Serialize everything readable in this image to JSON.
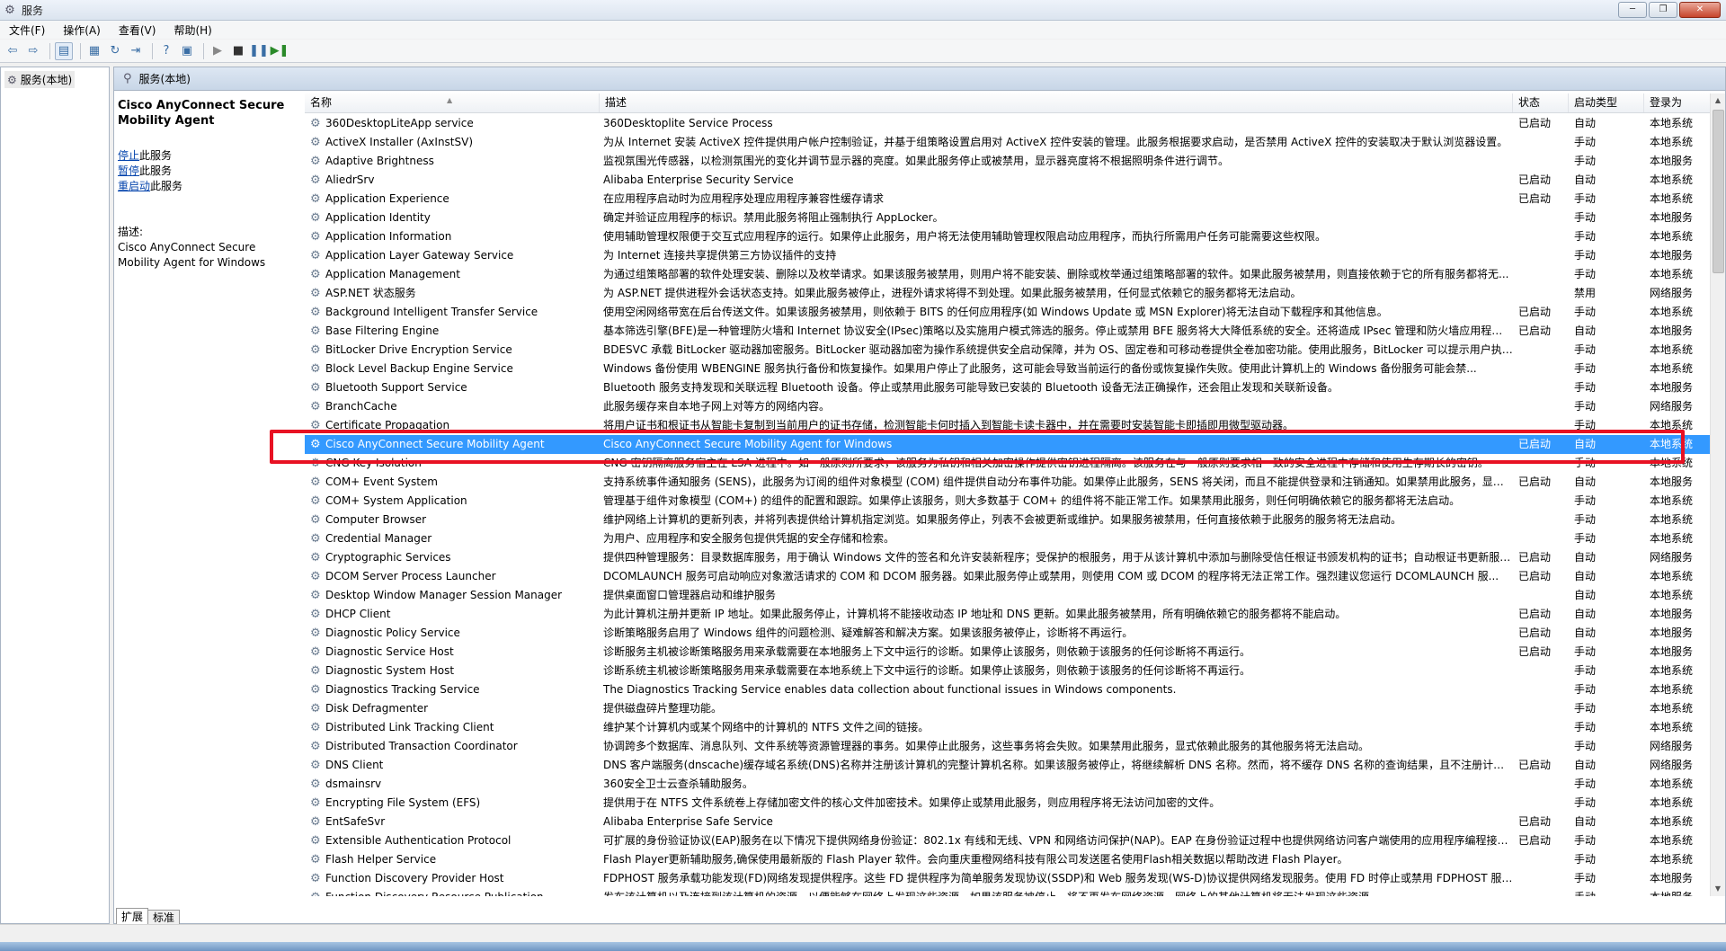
{
  "window": {
    "title": "服务"
  },
  "menu": [
    "文件(F)",
    "操作(A)",
    "查看(V)",
    "帮助(H)"
  ],
  "tree": {
    "root_label": "服务(本地)"
  },
  "main": {
    "header": "服务(本地)"
  },
  "detail": {
    "service_name": "Cisco AnyConnect Secure Mobility Agent",
    "actions": [
      {
        "link": "停止",
        "suffix": "此服务"
      },
      {
        "link": "暂停",
        "suffix": "此服务"
      },
      {
        "link": "重启动",
        "suffix": "此服务"
      }
    ],
    "desc_label": "描述:",
    "desc_text": "Cisco AnyConnect Secure Mobility Agent for Windows"
  },
  "columns": {
    "name": "名称",
    "desc": "描述",
    "status": "状态",
    "startup": "启动类型",
    "logon": "登录为"
  },
  "rows": [
    {
      "name": "360DesktopLiteApp service",
      "desc": "360Desktoplite Service Process",
      "status": "已启动",
      "startup": "自动",
      "logon": "本地系统"
    },
    {
      "name": "ActiveX Installer (AxInstSV)",
      "desc": "为从 Internet 安装 ActiveX 控件提供用户帐户控制验证，并基于组策略设置启用对 ActiveX 控件安装的管理。此服务根据要求启动，是否禁用 ActiveX 控件的安装取决于默认浏览器设置。",
      "status": "",
      "startup": "手动",
      "logon": "本地系统"
    },
    {
      "name": "Adaptive Brightness",
      "desc": "监视氛围光传感器，以检测氛围光的变化并调节显示器的亮度。如果此服务停止或被禁用，显示器亮度将不根据照明条件进行调节。",
      "status": "",
      "startup": "手动",
      "logon": "本地服务"
    },
    {
      "name": "AliedrSrv",
      "desc": "Alibaba Enterprise Security Service",
      "status": "已启动",
      "startup": "自动",
      "logon": "本地系统"
    },
    {
      "name": "Application Experience",
      "desc": "在应用程序启动时为应用程序处理应用程序兼容性缓存请求",
      "status": "已启动",
      "startup": "手动",
      "logon": "本地系统"
    },
    {
      "name": "Application Identity",
      "desc": "确定并验证应用程序的标识。禁用此服务将阻止强制执行 AppLocker。",
      "status": "",
      "startup": "手动",
      "logon": "本地服务"
    },
    {
      "name": "Application Information",
      "desc": "使用辅助管理权限便于交互式应用程序的运行。如果停止此服务，用户将无法使用辅助管理权限启动应用程序，而执行所需用户任务可能需要这些权限。",
      "status": "",
      "startup": "手动",
      "logon": "本地系统"
    },
    {
      "name": "Application Layer Gateway Service",
      "desc": "为 Internet 连接共享提供第三方协议插件的支持",
      "status": "",
      "startup": "手动",
      "logon": "本地服务"
    },
    {
      "name": "Application Management",
      "desc": "为通过组策略部署的软件处理安装、删除以及枚举请求。如果该服务被禁用，则用户将不能安装、删除或枚举通过组策略部署的软件。如果此服务被禁用，则直接依赖于它的所有服务都将无...",
      "status": "",
      "startup": "手动",
      "logon": "本地系统"
    },
    {
      "name": "ASP.NET 状态服务",
      "desc": "为 ASP.NET 提供进程外会话状态支持。如果此服务被停止，进程外请求将得不到处理。如果此服务被禁用，任何显式依赖它的服务都将无法启动。",
      "status": "",
      "startup": "禁用",
      "logon": "网络服务"
    },
    {
      "name": "Background Intelligent Transfer Service",
      "desc": "使用空闲网络带宽在后台传送文件。如果该服务被禁用，则依赖于 BITS 的任何应用程序(如 Windows Update 或 MSN Explorer)将无法自动下载程序和其他信息。",
      "status": "已启动",
      "startup": "手动",
      "logon": "本地系统"
    },
    {
      "name": "Base Filtering Engine",
      "desc": "基本筛选引擎(BFE)是一种管理防火墙和 Internet 协议安全(IPsec)策略以及实施用户模式筛选的服务。停止或禁用 BFE 服务将大大降低系统的安全。还将造成 IPsec 管理和防火墙应用程序产...",
      "status": "已启动",
      "startup": "自动",
      "logon": "本地服务"
    },
    {
      "name": "BitLocker Drive Encryption Service",
      "desc": "BDESVC 承载 BitLocker 驱动器加密服务。BitLocker 驱动器加密为操作系统提供安全启动保障，并为 OS、固定卷和可移动卷提供全卷加密功能。使用此服务，BitLocker 可以提示用户执行...",
      "status": "",
      "startup": "手动",
      "logon": "本地系统"
    },
    {
      "name": "Block Level Backup Engine Service",
      "desc": "Windows 备份使用 WBENGINE 服务执行备份和恢复操作。如果用户停止了此服务，这可能会导致当前运行的备份或恢复操作失败。使用此计算机上的 Windows 备份服务可能会禁...",
      "status": "",
      "startup": "手动",
      "logon": "本地系统"
    },
    {
      "name": "Bluetooth Support Service",
      "desc": "Bluetooth 服务支持发现和关联远程 Bluetooth 设备。停止或禁用此服务可能导致已安装的 Bluetooth 设备无法正确操作，还会阻止发现和关联新设备。",
      "status": "",
      "startup": "手动",
      "logon": "本地服务"
    },
    {
      "name": "BranchCache",
      "desc": "此服务缓存来自本地子网上对等方的网络内容。",
      "status": "",
      "startup": "手动",
      "logon": "网络服务"
    },
    {
      "name": "Certificate Propagation",
      "desc": "将用户证书和根证书从智能卡复制到当前用户的证书存储，检测智能卡何时插入到智能卡读卡器中，并在需要时安装智能卡即插即用微型驱动器。",
      "status": "",
      "startup": "手动",
      "logon": "本地系统"
    },
    {
      "name": "Cisco AnyConnect Secure Mobility Agent",
      "desc": "Cisco AnyConnect Secure Mobility Agent for Windows",
      "status": "已启动",
      "startup": "自动",
      "logon": "本地系统",
      "selected": true
    },
    {
      "name": "CNG Key Isolation",
      "desc": "CNG 密钥隔离服务宿主在 LSA 进程中。如一般原则所要求，该服务为私钥和相关加密操作提供密钥进程隔离。该服务在与一般原则要求相一致的安全进程中存储和使用生存期长的密钥。",
      "status": "",
      "startup": "手动",
      "logon": "本地系统"
    },
    {
      "name": "COM+ Event System",
      "desc": "支持系统事件通知服务 (SENS)，此服务为订阅的组件对象模型 (COM) 组件提供自动分布事件功能。如果停止此服务，SENS 将关闭，而且不能提供登录和注销通知。如果禁用此服务，显式...",
      "status": "已启动",
      "startup": "自动",
      "logon": "本地服务"
    },
    {
      "name": "COM+ System Application",
      "desc": "管理基于组件对象模型 (COM+) 的组件的配置和跟踪。如果停止该服务，则大多数基于 COM+ 的组件将不能正常工作。如果禁用此服务，则任何明确依赖它的服务都将无法启动。",
      "status": "",
      "startup": "手动",
      "logon": "本地系统"
    },
    {
      "name": "Computer Browser",
      "desc": "维护网络上计算机的更新列表，并将列表提供给计算机指定浏览。如果服务停止，列表不会被更新或维护。如果服务被禁用，任何直接依赖于此服务的服务将无法启动。",
      "status": "",
      "startup": "手动",
      "logon": "本地系统"
    },
    {
      "name": "Credential Manager",
      "desc": "为用户、应用程序和安全服务包提供凭据的安全存储和检索。",
      "status": "",
      "startup": "手动",
      "logon": "本地系统"
    },
    {
      "name": "Cryptographic Services",
      "desc": "提供四种管理服务：目录数据库服务，用于确认 Windows 文件的签名和允许安装新程序；受保护的根服务，用于从该计算机中添加与删除受信任根证书颁发机构的证书；自动根证书更新服务...",
      "status": "已启动",
      "startup": "自动",
      "logon": "网络服务"
    },
    {
      "name": "DCOM Server Process Launcher",
      "desc": "DCOMLAUNCH 服务可启动响应对象激活请求的 COM 和 DCOM 服务器。如果此服务停止或禁用，则使用 COM 或 DCOM 的程序将无法正常工作。强烈建议您运行 DCOMLAUNCH 服...",
      "status": "已启动",
      "startup": "自动",
      "logon": "本地系统"
    },
    {
      "name": "Desktop Window Manager Session Manager",
      "desc": "提供桌面窗口管理器启动和维护服务",
      "status": "",
      "startup": "自动",
      "logon": "本地系统"
    },
    {
      "name": "DHCP Client",
      "desc": "为此计算机注册并更新 IP 地址。如果此服务停止，计算机将不能接收动态 IP 地址和 DNS 更新。如果此服务被禁用，所有明确依赖它的服务都将不能启动。",
      "status": "已启动",
      "startup": "自动",
      "logon": "本地服务"
    },
    {
      "name": "Diagnostic Policy Service",
      "desc": "诊断策略服务启用了 Windows 组件的问题检测、疑难解答和解决方案。如果该服务被停止，诊断将不再运行。",
      "status": "已启动",
      "startup": "自动",
      "logon": "本地服务"
    },
    {
      "name": "Diagnostic Service Host",
      "desc": "诊断服务主机被诊断策略服务用来承载需要在本地服务上下文中运行的诊断。如果停止该服务，则依赖于该服务的任何诊断将不再运行。",
      "status": "已启动",
      "startup": "手动",
      "logon": "本地服务"
    },
    {
      "name": "Diagnostic System Host",
      "desc": "诊断系统主机被诊断策略服务用来承载需要在本地系统上下文中运行的诊断。如果停止该服务，则依赖于该服务的任何诊断将不再运行。",
      "status": "",
      "startup": "手动",
      "logon": "本地系统"
    },
    {
      "name": "Diagnostics Tracking Service",
      "desc": "The Diagnostics Tracking Service enables data collection about functional issues in Windows components.",
      "status": "",
      "startup": "手动",
      "logon": "本地系统"
    },
    {
      "name": "Disk Defragmenter",
      "desc": "提供磁盘碎片整理功能。",
      "status": "",
      "startup": "手动",
      "logon": "本地系统"
    },
    {
      "name": "Distributed Link Tracking Client",
      "desc": "维护某个计算机内或某个网络中的计算机的 NTFS 文件之间的链接。",
      "status": "",
      "startup": "手动",
      "logon": "本地系统"
    },
    {
      "name": "Distributed Transaction Coordinator",
      "desc": "协调跨多个数据库、消息队列、文件系统等资源管理器的事务。如果停止此服务，这些事务将会失败。如果禁用此服务，显式依赖此服务的其他服务将无法启动。",
      "status": "",
      "startup": "手动",
      "logon": "网络服务"
    },
    {
      "name": "DNS Client",
      "desc": "DNS 客户端服务(dnscache)缓存域名系统(DNS)名称并注册该计算机的完整计算机名称。如果该服务被停止，将继续解析 DNS 名称。然而，将不缓存 DNS 名称的查询结果，且不注册计算...",
      "status": "已启动",
      "startup": "自动",
      "logon": "网络服务"
    },
    {
      "name": "dsmainsrv",
      "desc": "360安全卫士云查杀辅助服务。",
      "status": "",
      "startup": "手动",
      "logon": "本地系统"
    },
    {
      "name": "Encrypting File System (EFS)",
      "desc": "提供用于在 NTFS 文件系统卷上存储加密文件的核心文件加密技术。如果停止或禁用此服务，则应用程序将无法访问加密的文件。",
      "status": "",
      "startup": "手动",
      "logon": "本地系统"
    },
    {
      "name": "EntSafeSvr",
      "desc": "Alibaba Enterprise Safe Service",
      "status": "已启动",
      "startup": "自动",
      "logon": "本地系统"
    },
    {
      "name": "Extensible Authentication Protocol",
      "desc": "可扩展的身份验证协议(EAP)服务在以下情况下提供网络身份验证：802.1x 有线和无线、VPN 和网络访问保护(NAP)。EAP 在身份验证过程中也提供网络访问客户端使用的应用程序编程接口(A...",
      "status": "已启动",
      "startup": "手动",
      "logon": "本地系统"
    },
    {
      "name": "Flash Helper Service",
      "desc": "Flash Player更新辅助服务,确保使用最新版的 Flash Player 软件。会向重庆重橙网络科技有限公司发送匿名使用Flash相关数据以帮助改进 Flash Player。",
      "status": "",
      "startup": "手动",
      "logon": "本地系统"
    },
    {
      "name": "Function Discovery Provider Host",
      "desc": "FDPHOST 服务承载功能发现(FD)网络发现提供程序。这些 FD 提供程序为简单服务发现协议(SSDP)和 Web 服务发现(WS-D)协议提供网络发现服务。使用 FD 时停止或禁用 FDPHOST 服务...",
      "status": "",
      "startup": "手动",
      "logon": "本地服务"
    },
    {
      "name": "Function Discovery Resource Publication",
      "desc": "发布该计算机以及连接到该计算机的资源，以便能够在网络上发现这些资源。如果该服务被停止，将不再发布网络资源，网络上的其他计算机将无法发现这些资源。",
      "status": "",
      "startup": "手动",
      "logon": "本地服务"
    }
  ],
  "tabs": [
    "扩展",
    "标准"
  ],
  "icons": {
    "service": "gear-icon",
    "back": "arrow-left-icon",
    "forward": "arrow-right-icon"
  }
}
